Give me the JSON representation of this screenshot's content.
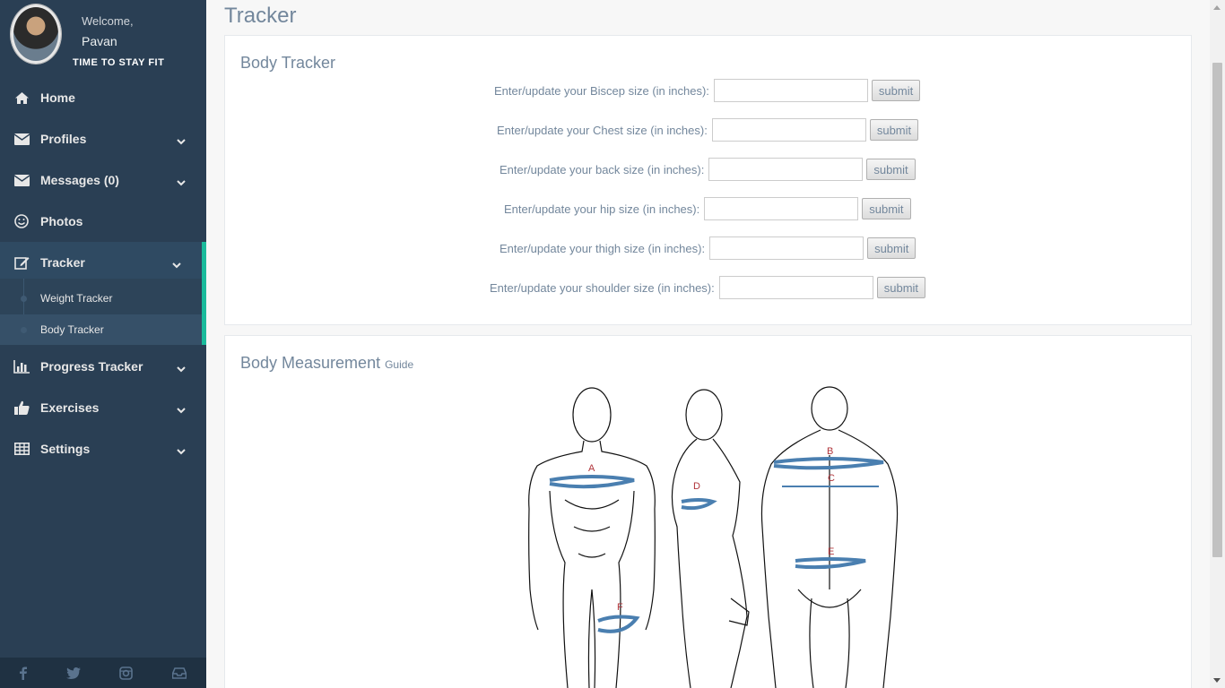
{
  "profile": {
    "welcome": "Welcome,",
    "name": "Pavan",
    "tagline": "TIME TO STAY FIT"
  },
  "sidebar": {
    "items": [
      {
        "label": "Home",
        "icon": "home-icon"
      },
      {
        "label": "Profiles",
        "icon": "envelope-icon"
      },
      {
        "label": "Messages (0)",
        "icon": "envelope-icon"
      },
      {
        "label": "Photos",
        "icon": "smile-icon"
      },
      {
        "label": "Tracker",
        "icon": "edit-icon"
      },
      {
        "label": "Progress Tracker",
        "icon": "bar-chart-icon"
      },
      {
        "label": "Exercises",
        "icon": "thumbs-up-icon"
      },
      {
        "label": "Settings",
        "icon": "table-icon"
      }
    ],
    "tracker_sub": [
      "Weight Tracker",
      "Body Tracker"
    ]
  },
  "page": {
    "title": "Tracker"
  },
  "body_tracker": {
    "title": "Body Tracker",
    "fields": [
      {
        "label": "Enter/update your Biscep size (in inches):",
        "value": "",
        "button": "submit"
      },
      {
        "label": "Enter/update your Chest size (in inches):",
        "value": "",
        "button": "submit"
      },
      {
        "label": "Enter/update your back size (in inches):",
        "value": "",
        "button": "submit"
      },
      {
        "label": "Enter/update your hip size (in inches):",
        "value": "",
        "button": "submit"
      },
      {
        "label": "Enter/update your thigh size (in inches):",
        "value": "",
        "button": "submit"
      },
      {
        "label": "Enter/update your shoulder size (in inches):",
        "value": "",
        "button": "submit"
      }
    ]
  },
  "guide": {
    "title": "Body Measurement",
    "subtitle": "Guide",
    "labels": [
      "A",
      "B",
      "C",
      "D",
      "E",
      "F"
    ]
  },
  "footer_icons": [
    "facebook-icon",
    "twitter-icon",
    "instagram-icon",
    "inbox-icon"
  ],
  "colors": {
    "sidebar": "#2a3f54",
    "accent": "#1abb9c",
    "text": "#73879c",
    "label_red": "#b0343a",
    "arrow_blue": "#4a7fb0"
  }
}
